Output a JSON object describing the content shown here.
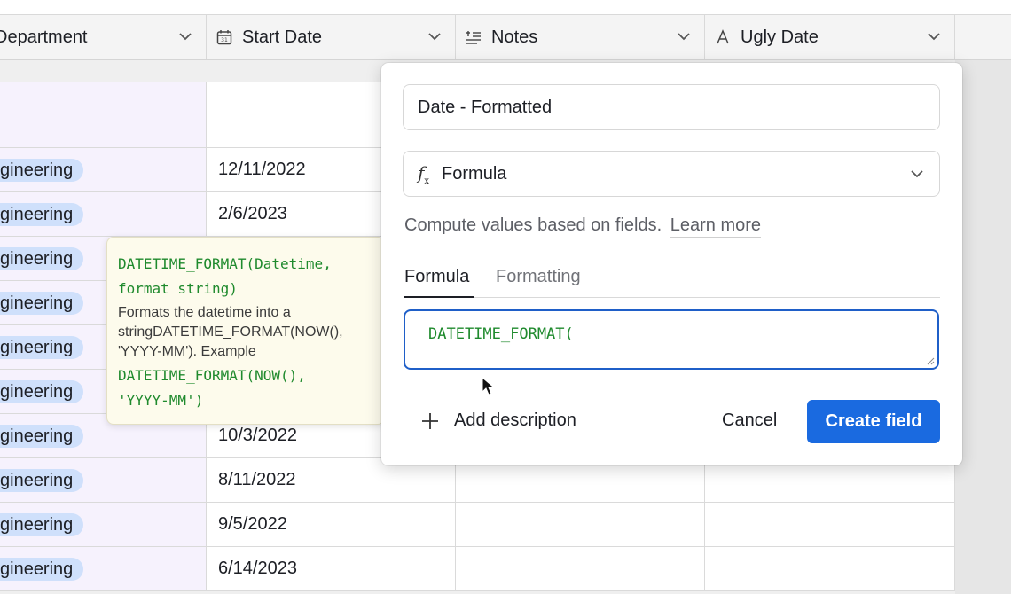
{
  "header": {
    "columns": [
      {
        "label": "Department",
        "icon": "none"
      },
      {
        "label": "Start Date",
        "icon": "calendar-icon"
      },
      {
        "label": "Notes",
        "icon": "long-text-icon"
      },
      {
        "label": "Ugly Date",
        "icon": "single-line-text-icon"
      }
    ]
  },
  "rows": [
    {
      "dept": "",
      "date": ""
    },
    {
      "dept": "gineering",
      "date": "12/11/2022"
    },
    {
      "dept": "gineering",
      "date": "2/6/2023"
    },
    {
      "dept": "gineering",
      "date": ""
    },
    {
      "dept": "gineering",
      "date": ""
    },
    {
      "dept": "gineering",
      "date": ""
    },
    {
      "dept": "gineering",
      "date": ""
    },
    {
      "dept": "gineering",
      "date": "10/3/2022"
    },
    {
      "dept": "gineering",
      "date": "8/11/2022"
    },
    {
      "dept": "gineering",
      "date": "9/5/2022"
    },
    {
      "dept": "gineering",
      "date": "6/14/2023"
    }
  ],
  "tooltip": {
    "signature": "DATETIME_FORMAT(Datetime,\nformat string)",
    "description": "Formats the datetime into a stringDATETIME_FORMAT(NOW(), 'YYYY-MM'). Example",
    "example": "DATETIME_FORMAT(NOW(),\n'YYYY-MM')"
  },
  "panel": {
    "field_name": "Date - Formatted",
    "field_type": "Formula",
    "help_text": "Compute values based on fields.",
    "learn_more": "Learn more",
    "tabs": [
      "Formula",
      "Formatting"
    ],
    "formula_value": "DATETIME_FORMAT(",
    "add_description": "Add description",
    "cancel": "Cancel",
    "create": "Create field"
  },
  "colors": {
    "accent": "#1a6ae0",
    "formula_text": "#1f8a2d",
    "pill": "#cfe0fb",
    "dept_col_bg": "#f6f2fd",
    "tooltip_bg": "#fdfbec"
  }
}
